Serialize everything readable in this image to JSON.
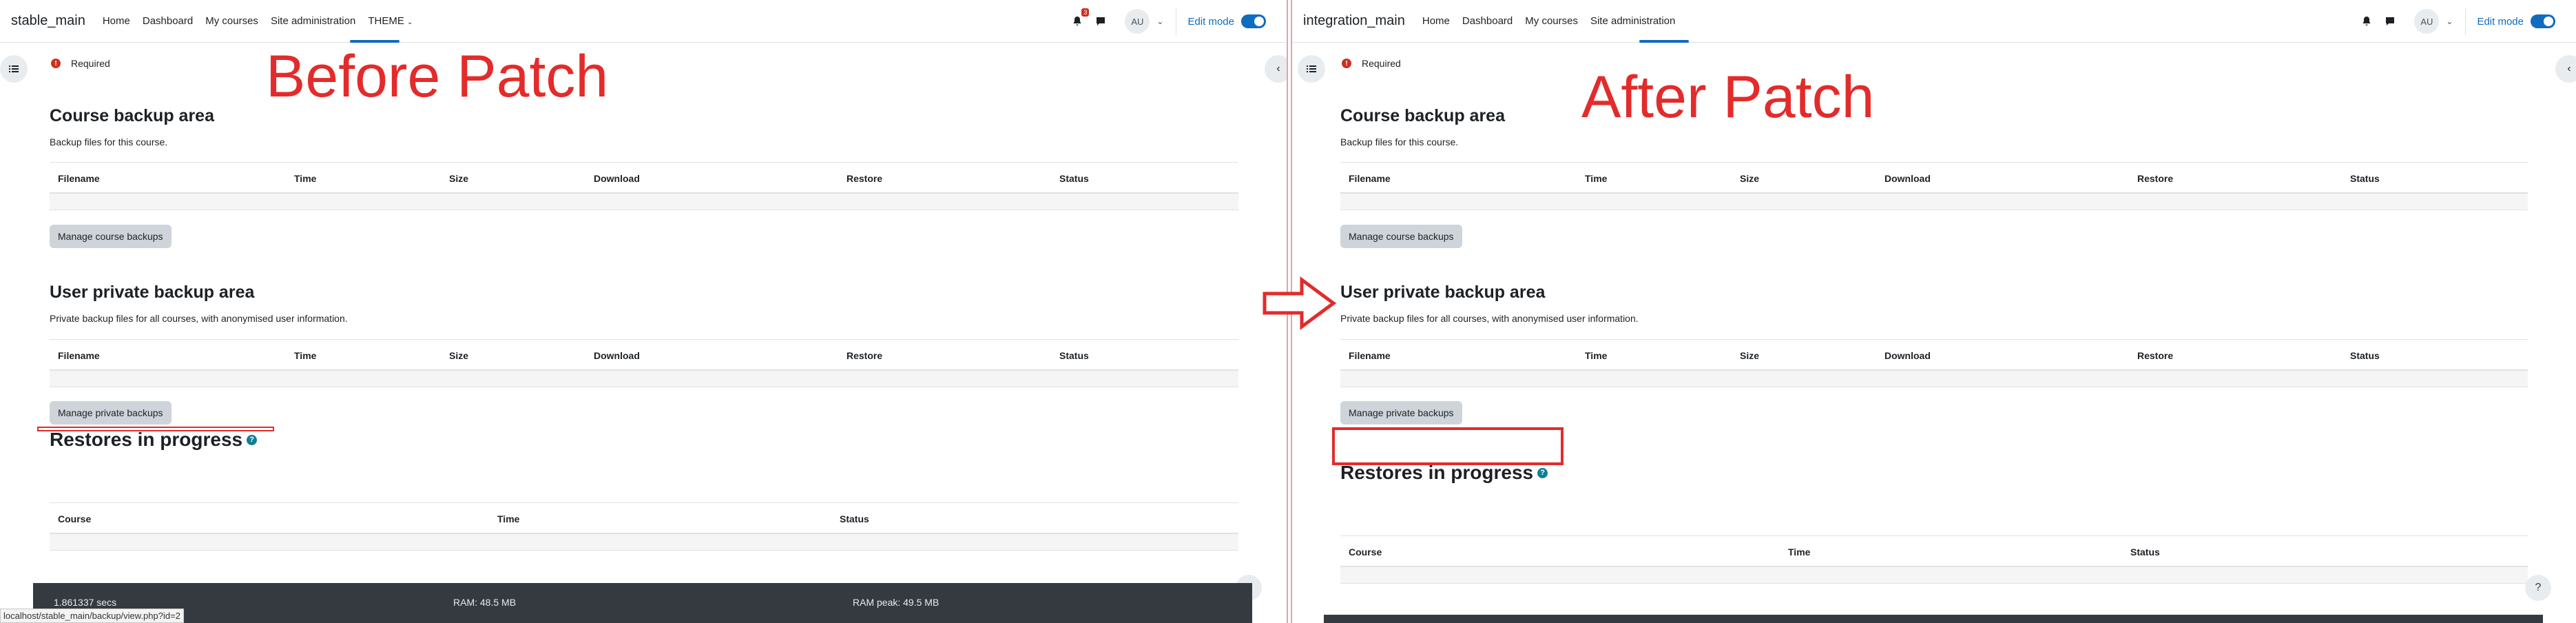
{
  "left": {
    "brand": "stable_main",
    "nav": [
      "Home",
      "Dashboard",
      "My courses",
      "Site administration",
      "THEME"
    ],
    "badge_count": "3",
    "avatar": "AU",
    "edit_mode": "Edit mode",
    "required": "Required",
    "overlay": "Before Patch",
    "course_backup": {
      "title": "Course backup area",
      "desc": "Backup files for this course.",
      "button": "Manage course backups"
    },
    "user_backup": {
      "title": "User private backup area",
      "desc": "Private backup files for all courses, with anonymised user information.",
      "button": "Manage private backups"
    },
    "restores": {
      "title": "Restores in progress",
      "columns": [
        "Course",
        "Time",
        "Status"
      ]
    },
    "footer": {
      "secs": "1.861337 secs",
      "ram": "RAM: 48.5 MB",
      "ram_peak": "RAM peak: 49.5 MB"
    },
    "status_url": "localhost/stable_main/backup/view.php?id=2"
  },
  "right": {
    "brand": "integration_main",
    "nav": [
      "Home",
      "Dashboard",
      "My courses",
      "Site administration"
    ],
    "avatar": "AU",
    "edit_mode": "Edit mode",
    "required": "Required",
    "overlay": "After Patch",
    "course_backup": {
      "title": "Course backup area",
      "desc": "Backup files for this course.",
      "button": "Manage course backups"
    },
    "user_backup": {
      "title": "User private backup area",
      "desc": "Private backup files for all courses, with anonymised user information.",
      "button": "Manage private backups"
    },
    "restores": {
      "title": "Restores in progress",
      "columns": [
        "Course",
        "Time",
        "Status"
      ]
    }
  },
  "backup_columns": [
    "Filename",
    "Time",
    "Size",
    "Download",
    "Restore",
    "Status"
  ],
  "help_glyph": "?",
  "colors": {
    "accent": "#0f6cbf",
    "annotation_red": "#e32b2b",
    "footer": "#343a40"
  }
}
